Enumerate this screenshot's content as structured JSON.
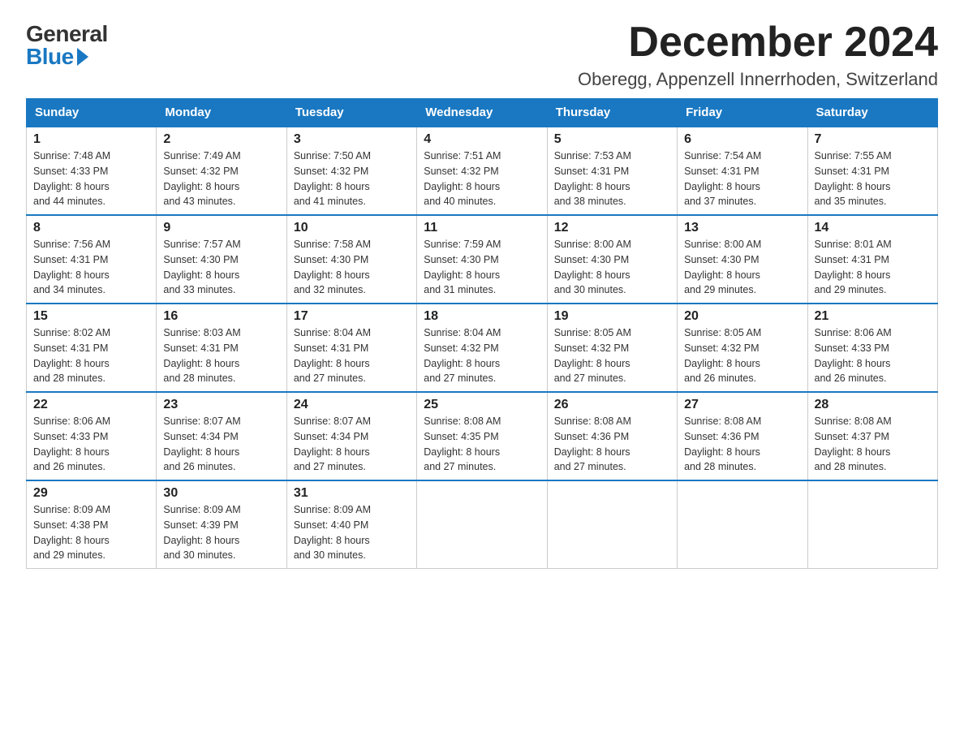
{
  "logo": {
    "general": "General",
    "blue": "Blue"
  },
  "title": "December 2024",
  "location": "Oberegg, Appenzell Innerrhoden, Switzerland",
  "weekdays": [
    "Sunday",
    "Monday",
    "Tuesday",
    "Wednesday",
    "Thursday",
    "Friday",
    "Saturday"
  ],
  "weeks": [
    [
      {
        "day": "1",
        "sunrise": "7:48 AM",
        "sunset": "4:33 PM",
        "daylight": "8 hours and 44 minutes."
      },
      {
        "day": "2",
        "sunrise": "7:49 AM",
        "sunset": "4:32 PM",
        "daylight": "8 hours and 43 minutes."
      },
      {
        "day": "3",
        "sunrise": "7:50 AM",
        "sunset": "4:32 PM",
        "daylight": "8 hours and 41 minutes."
      },
      {
        "day": "4",
        "sunrise": "7:51 AM",
        "sunset": "4:32 PM",
        "daylight": "8 hours and 40 minutes."
      },
      {
        "day": "5",
        "sunrise": "7:53 AM",
        "sunset": "4:31 PM",
        "daylight": "8 hours and 38 minutes."
      },
      {
        "day": "6",
        "sunrise": "7:54 AM",
        "sunset": "4:31 PM",
        "daylight": "8 hours and 37 minutes."
      },
      {
        "day": "7",
        "sunrise": "7:55 AM",
        "sunset": "4:31 PM",
        "daylight": "8 hours and 35 minutes."
      }
    ],
    [
      {
        "day": "8",
        "sunrise": "7:56 AM",
        "sunset": "4:31 PM",
        "daylight": "8 hours and 34 minutes."
      },
      {
        "day": "9",
        "sunrise": "7:57 AM",
        "sunset": "4:30 PM",
        "daylight": "8 hours and 33 minutes."
      },
      {
        "day": "10",
        "sunrise": "7:58 AM",
        "sunset": "4:30 PM",
        "daylight": "8 hours and 32 minutes."
      },
      {
        "day": "11",
        "sunrise": "7:59 AM",
        "sunset": "4:30 PM",
        "daylight": "8 hours and 31 minutes."
      },
      {
        "day": "12",
        "sunrise": "8:00 AM",
        "sunset": "4:30 PM",
        "daylight": "8 hours and 30 minutes."
      },
      {
        "day": "13",
        "sunrise": "8:00 AM",
        "sunset": "4:30 PM",
        "daylight": "8 hours and 29 minutes."
      },
      {
        "day": "14",
        "sunrise": "8:01 AM",
        "sunset": "4:31 PM",
        "daylight": "8 hours and 29 minutes."
      }
    ],
    [
      {
        "day": "15",
        "sunrise": "8:02 AM",
        "sunset": "4:31 PM",
        "daylight": "8 hours and 28 minutes."
      },
      {
        "day": "16",
        "sunrise": "8:03 AM",
        "sunset": "4:31 PM",
        "daylight": "8 hours and 28 minutes."
      },
      {
        "day": "17",
        "sunrise": "8:04 AM",
        "sunset": "4:31 PM",
        "daylight": "8 hours and 27 minutes."
      },
      {
        "day": "18",
        "sunrise": "8:04 AM",
        "sunset": "4:32 PM",
        "daylight": "8 hours and 27 minutes."
      },
      {
        "day": "19",
        "sunrise": "8:05 AM",
        "sunset": "4:32 PM",
        "daylight": "8 hours and 27 minutes."
      },
      {
        "day": "20",
        "sunrise": "8:05 AM",
        "sunset": "4:32 PM",
        "daylight": "8 hours and 26 minutes."
      },
      {
        "day": "21",
        "sunrise": "8:06 AM",
        "sunset": "4:33 PM",
        "daylight": "8 hours and 26 minutes."
      }
    ],
    [
      {
        "day": "22",
        "sunrise": "8:06 AM",
        "sunset": "4:33 PM",
        "daylight": "8 hours and 26 minutes."
      },
      {
        "day": "23",
        "sunrise": "8:07 AM",
        "sunset": "4:34 PM",
        "daylight": "8 hours and 26 minutes."
      },
      {
        "day": "24",
        "sunrise": "8:07 AM",
        "sunset": "4:34 PM",
        "daylight": "8 hours and 27 minutes."
      },
      {
        "day": "25",
        "sunrise": "8:08 AM",
        "sunset": "4:35 PM",
        "daylight": "8 hours and 27 minutes."
      },
      {
        "day": "26",
        "sunrise": "8:08 AM",
        "sunset": "4:36 PM",
        "daylight": "8 hours and 27 minutes."
      },
      {
        "day": "27",
        "sunrise": "8:08 AM",
        "sunset": "4:36 PM",
        "daylight": "8 hours and 28 minutes."
      },
      {
        "day": "28",
        "sunrise": "8:08 AM",
        "sunset": "4:37 PM",
        "daylight": "8 hours and 28 minutes."
      }
    ],
    [
      {
        "day": "29",
        "sunrise": "8:09 AM",
        "sunset": "4:38 PM",
        "daylight": "8 hours and 29 minutes."
      },
      {
        "day": "30",
        "sunrise": "8:09 AM",
        "sunset": "4:39 PM",
        "daylight": "8 hours and 30 minutes."
      },
      {
        "day": "31",
        "sunrise": "8:09 AM",
        "sunset": "4:40 PM",
        "daylight": "8 hours and 30 minutes."
      },
      null,
      null,
      null,
      null
    ]
  ],
  "labels": {
    "sunrise": "Sunrise:",
    "sunset": "Sunset:",
    "daylight": "Daylight:"
  }
}
